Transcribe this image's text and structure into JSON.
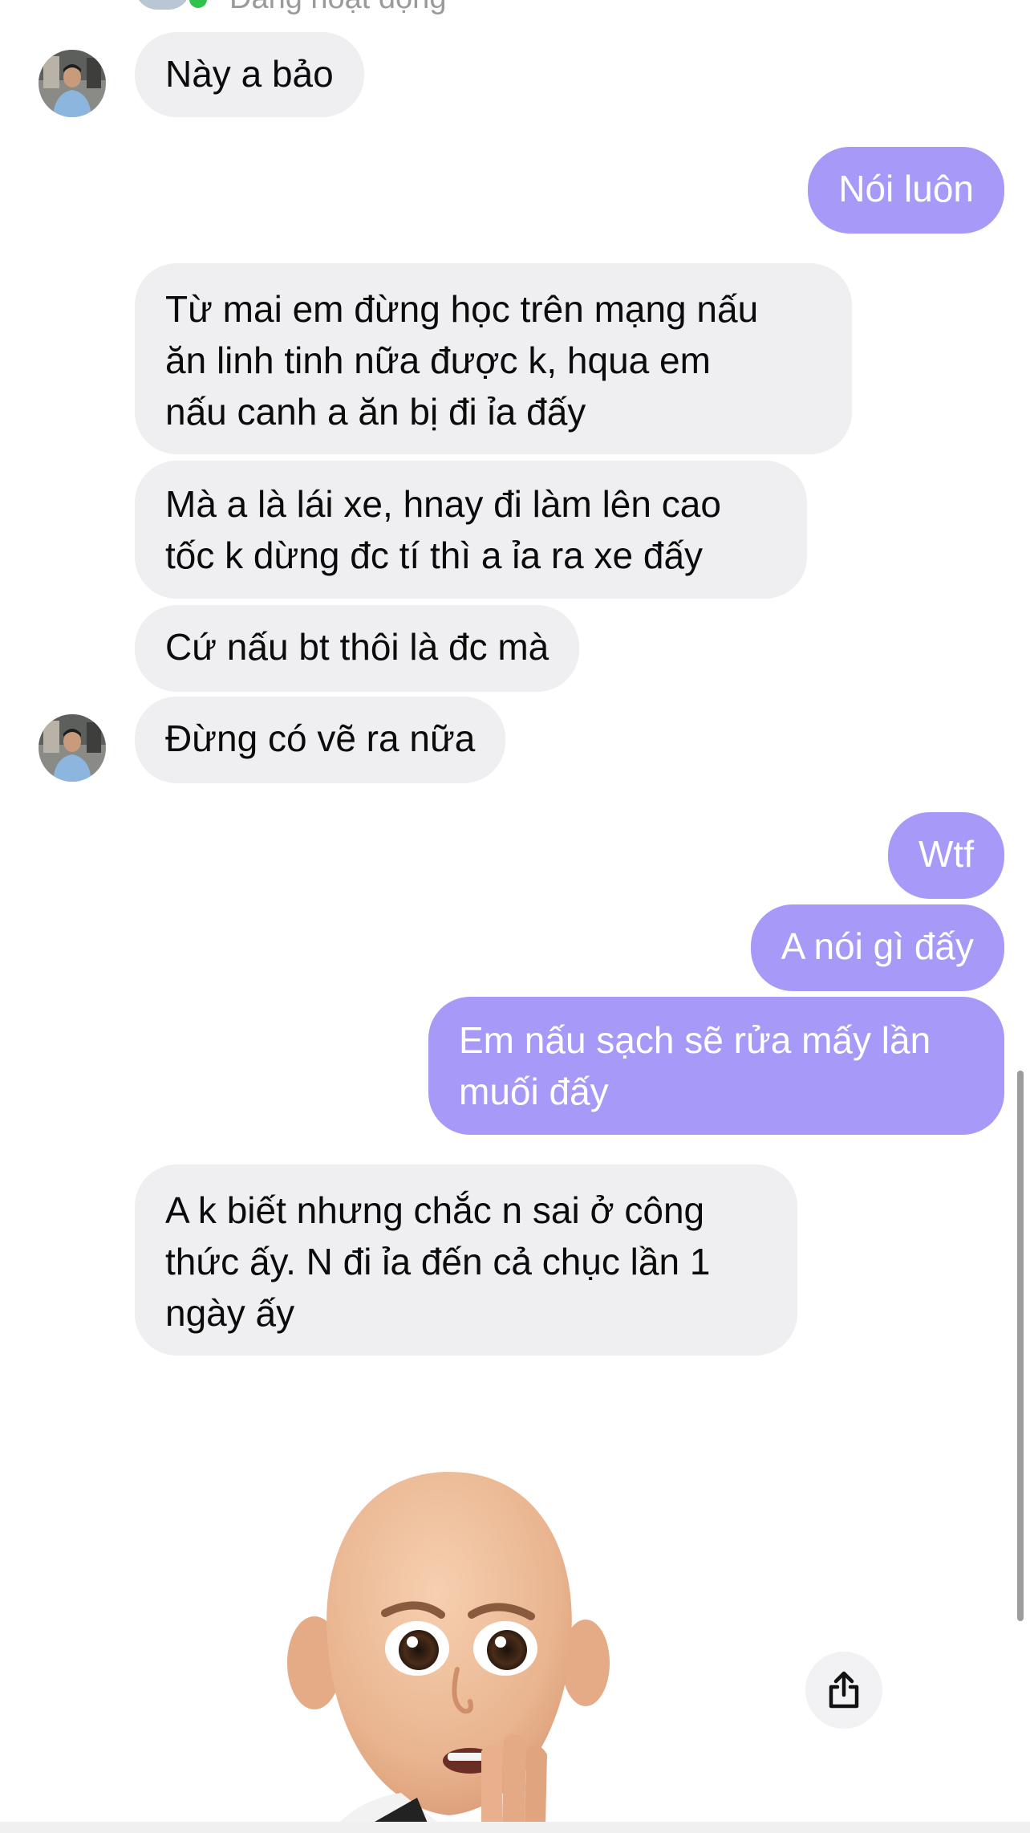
{
  "header": {
    "status_text": "Đang hoạt động"
  },
  "messages": [
    {
      "direction": "in",
      "text": "Này a bảo",
      "has_avatar": true
    },
    {
      "direction": "out",
      "text": "Nói luôn"
    },
    {
      "direction": "in",
      "text": "Từ mai em đừng học trên mạng nấu\năn linh tinh nữa được k, hqua em\nnấu canh a ăn bị đi ỉa đấy"
    },
    {
      "direction": "in",
      "text": "Mà a là lái xe, hnay đi làm lên cao\ntốc k dừng đc tí thì a ỉa ra xe đấy"
    },
    {
      "direction": "in",
      "text": "Cứ nấu bt thôi là đc mà"
    },
    {
      "direction": "in",
      "text": "Đừng có vẽ ra nữa",
      "has_avatar": true
    },
    {
      "direction": "out",
      "text": "Wtf"
    },
    {
      "direction": "out",
      "text": "A nói gì đấy"
    },
    {
      "direction": "out",
      "text": "Em nấu sạch sẽ rửa mấy lần\nmuối đấy"
    },
    {
      "direction": "in",
      "text": "A k biết nhưng chắc n sai ở công\nthức ấy. N đi ỉa đến cả chục lần 1\nngày ấy"
    }
  ],
  "sticker": {
    "type": "memoji",
    "icon": "worried-memoji-icon"
  },
  "colors": {
    "incoming_bubble": "#efeff1",
    "outgoing_bubble": "#a799f8",
    "online_dot": "#31c24d"
  }
}
